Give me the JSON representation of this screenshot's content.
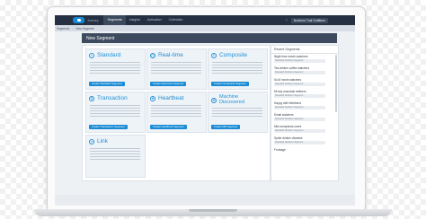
{
  "topnav": {
    "app_name": "Journey",
    "tabs": [
      {
        "label": "Segments",
        "active": true
      },
      {
        "label": "Insights",
        "active": false
      },
      {
        "label": "Activation",
        "active": false
      },
      {
        "label": "Collection",
        "active": false
      }
    ],
    "business_unit": "Northern Trail Outfitters"
  },
  "breadcrumb": [
    "Segments",
    "New Segment"
  ],
  "page_title": "New Segment",
  "cards": [
    {
      "title": "Standard",
      "button": "Create Standard Segment",
      "icon": "user-icon"
    },
    {
      "title": "Real-time",
      "button": "Create Real-time Segment",
      "icon": "clock-icon"
    },
    {
      "title": "Composite",
      "button": "Create Composite Segment",
      "icon": "layers-icon"
    },
    {
      "title": "Transaction",
      "button": "Create Transaction Segment",
      "icon": "cart-icon"
    },
    {
      "title": "Heartbeat",
      "button": "Create Heartbeat Segment",
      "icon": "heart-icon"
    },
    {
      "title": "Machine Discovered",
      "button": "Create MD Segment",
      "icon": "gear-icon"
    },
    {
      "title": "Link",
      "button": "",
      "icon": "link-icon"
    }
  ],
  "recent": {
    "header": "Recent Segments",
    "items": [
      {
        "name": "Night time movie watchers",
        "tag": "Standard Northern Segment"
      },
      {
        "name": "Tea-drinker coffee watchers",
        "tag": "Standard Northern Segment"
      },
      {
        "name": "Sci-fi movie watchers",
        "tag": "Standard Northern Segment"
      },
      {
        "name": "Mt sky mountain trekkers",
        "tag": "Standard Northern Segment"
      },
      {
        "name": "Happy with Weekend",
        "tag": "Standard Northern Segment"
      },
      {
        "name": "Email watchers",
        "tag": "Standard Northern Segment"
      },
      {
        "name": "Mini-scrapbook users",
        "tag": "Standard Northern Segment"
      },
      {
        "name": "Sprite drinker vitamins",
        "tag": "Standard Northern Segment"
      },
      {
        "name": "Frontage",
        "tag": ""
      }
    ]
  },
  "colors": {
    "nav": "#253142",
    "accent": "#1a8bd4",
    "title_bar": "#3e4b5e"
  }
}
